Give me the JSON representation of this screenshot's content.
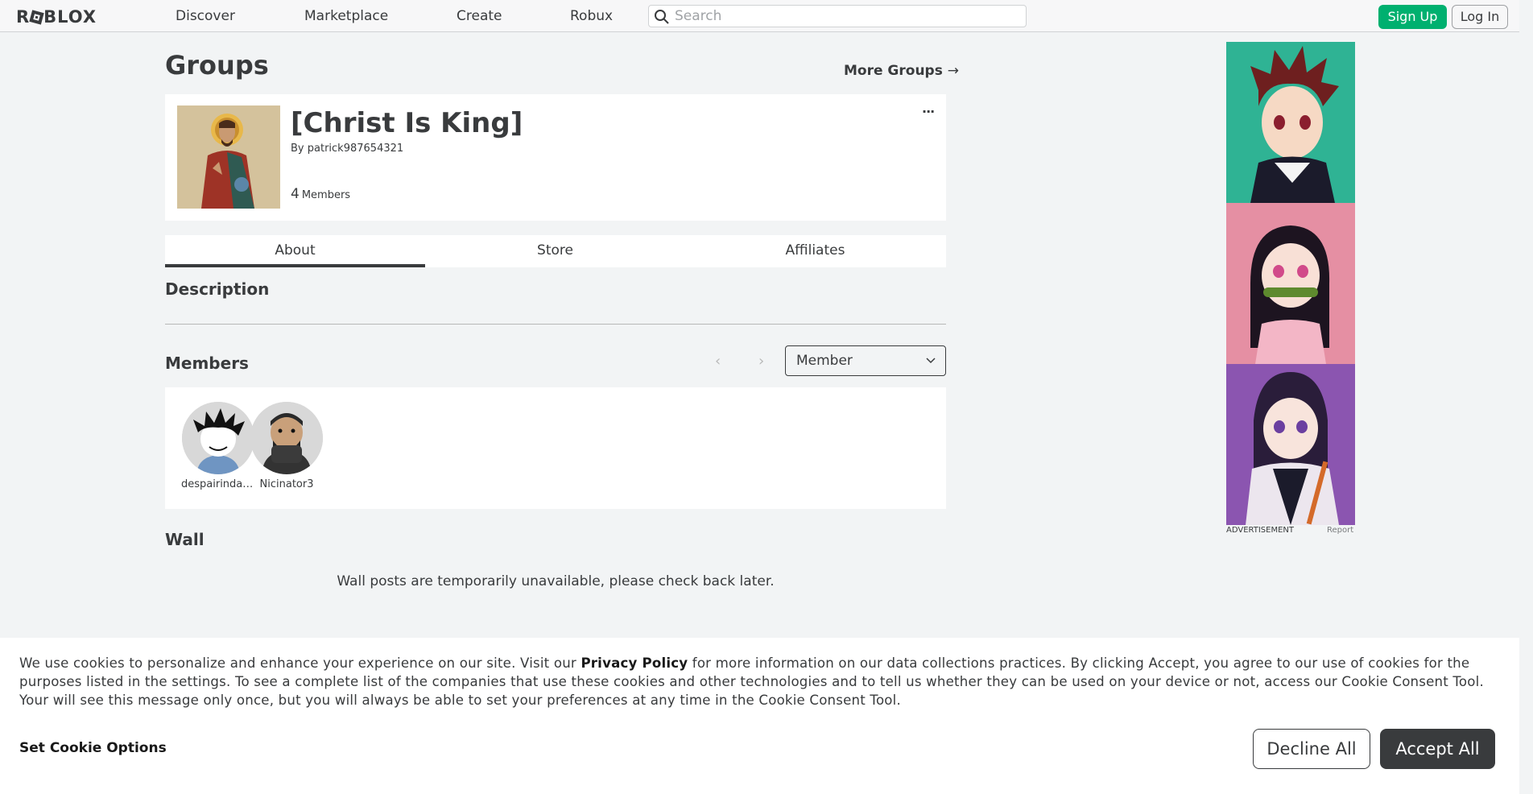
{
  "header": {
    "logo_text": "ROBLOX",
    "nav": [
      "Discover",
      "Marketplace",
      "Create",
      "Robux"
    ],
    "search_placeholder": "Search",
    "signup_label": "Sign Up",
    "login_label": "Log In"
  },
  "page": {
    "title": "Groups",
    "more_groups": "More Groups"
  },
  "group": {
    "name": "[Christ Is King]",
    "by_label": "By",
    "owner": "patrick987654321",
    "member_count": "4",
    "members_label": "Members",
    "more_icon": "ellipsis-icon"
  },
  "tabs": [
    "About",
    "Store",
    "Affiliates"
  ],
  "sections": {
    "description_title": "Description",
    "members_title": "Members",
    "wall_title": "Wall",
    "wall_message": "Wall posts are temporarily unavailable, please check back later."
  },
  "members": {
    "role_selected": "Member",
    "list": [
      {
        "name": "despairindar..."
      },
      {
        "name": "Nicinator3"
      }
    ]
  },
  "ad": {
    "label": "ADVERTISEMENT",
    "report": "Report"
  },
  "cookie": {
    "text_before": "We use cookies to personalize and enhance your experience on our site. Visit our ",
    "privacy_link": "Privacy Policy",
    "text_after": " for more information on our data collections practices. By clicking Accept, you agree to our use of cookies for the purposes listed in the settings. To see a complete list of the companies that use these cookies and other technologies and to tell us whether they can be used on your device or not, access our Cookie Consent Tool. Your will see this message only once, but you will always be able to set your preferences at any time in the Cookie Consent Tool.",
    "set_options": "Set Cookie Options",
    "decline": "Decline All",
    "accept": "Accept All"
  },
  "colors": {
    "signup_green": "#00b06f",
    "background": "#f2f4f5",
    "text": "#393b3d"
  }
}
